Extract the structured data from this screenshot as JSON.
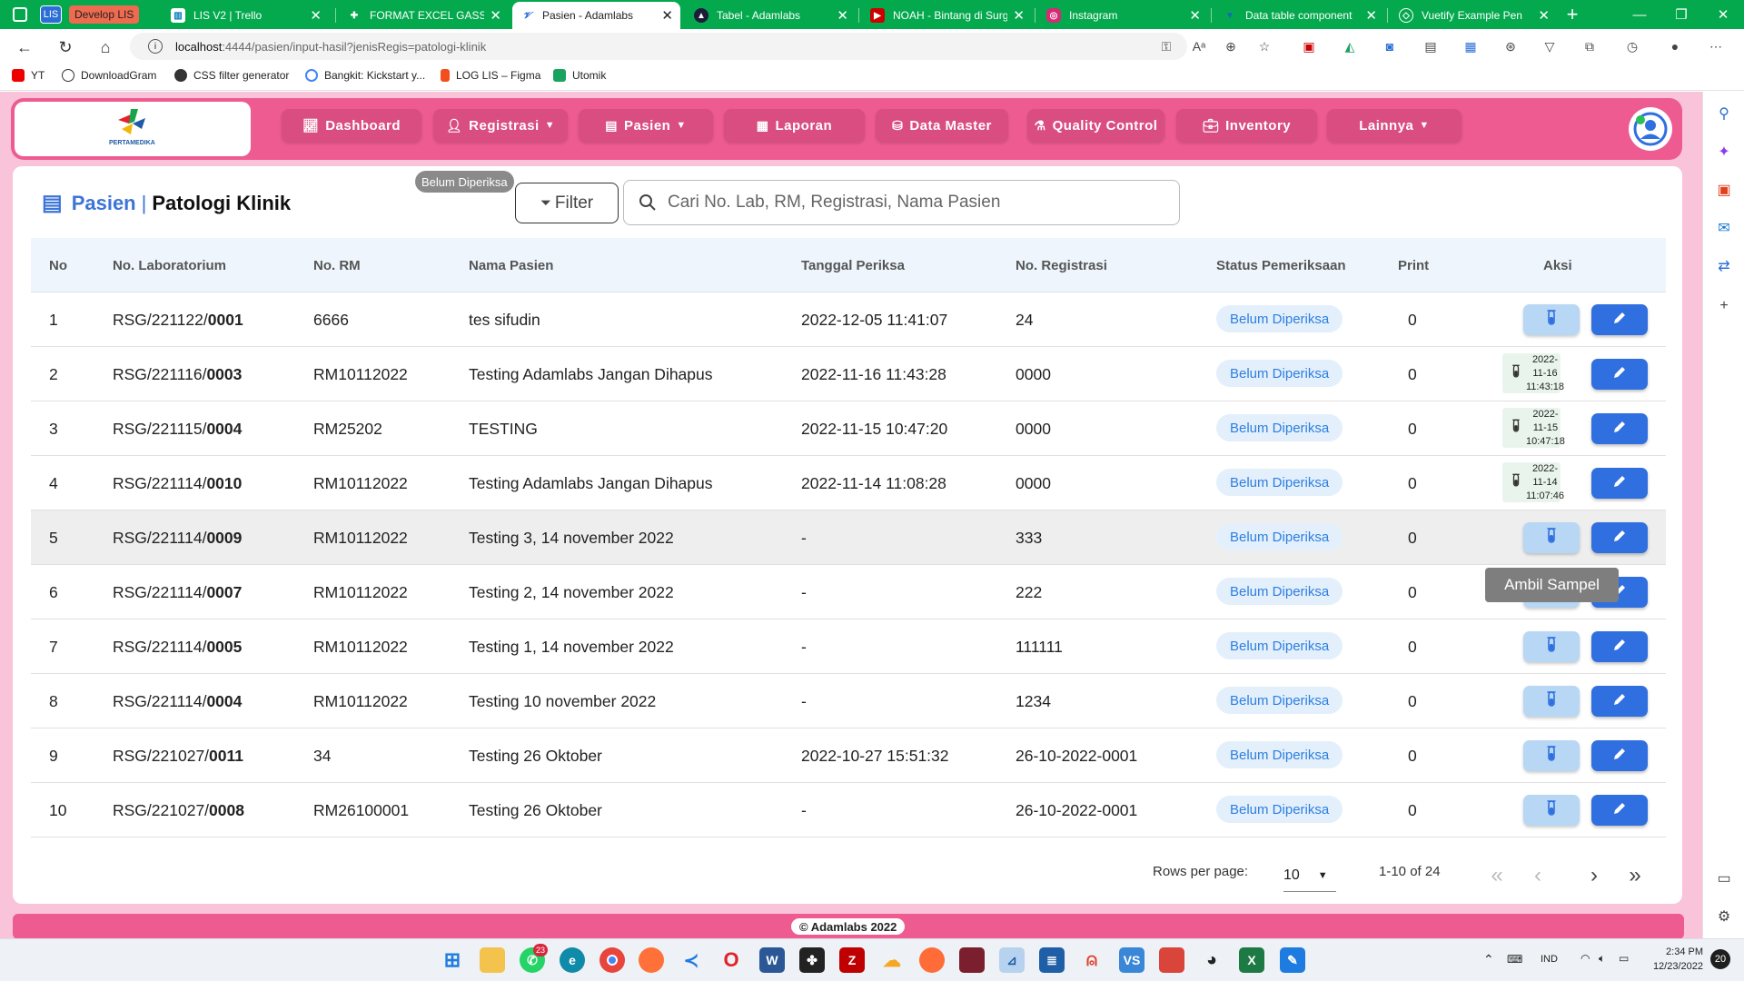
{
  "browser": {
    "tabs": [
      {
        "label": "Develop LIS",
        "type": "group"
      },
      {
        "label": "LIS V2 | Trello"
      },
      {
        "label": "FORMAT EXCEL GASS.xlsx"
      },
      {
        "label": "Pasien - Adamlabs",
        "active": true
      },
      {
        "label": "Tabel - Adamlabs"
      },
      {
        "label": "NOAH - Bintang di Surga"
      },
      {
        "label": "Instagram"
      },
      {
        "label": "Data table component"
      },
      {
        "label": "Vuetify Example Pen"
      }
    ],
    "group_label": "LIS",
    "url_host": "localhost",
    "url_rest": ":4444/pasien/input-hasil?jenisRegis=patologi-klinik",
    "bookmarks": [
      "YT",
      "DownloadGram",
      "CSS filter generator",
      "Bangkit: Kickstart y...",
      "LOG LIS – Figma",
      "Utomik"
    ]
  },
  "app": {
    "logo_text": "PERTAMEDIKA",
    "nav": [
      {
        "label": "Dashboard",
        "icon": "chart-line-icon",
        "dropdown": false
      },
      {
        "label": "Registrasi",
        "icon": "user-plus-icon",
        "dropdown": true
      },
      {
        "label": "Pasien",
        "icon": "clipboard-icon",
        "dropdown": true
      },
      {
        "label": "Laporan",
        "icon": "newspaper-icon",
        "dropdown": false
      },
      {
        "label": "Data Master",
        "icon": "database-icon",
        "dropdown": false
      },
      {
        "label": "Quality Control",
        "icon": "vials-icon",
        "dropdown": false
      },
      {
        "label": "Inventory",
        "icon": "briefcase-icon",
        "dropdown": false
      },
      {
        "label": "Lainnya",
        "icon": "",
        "dropdown": true
      }
    ],
    "colors": {
      "brand": "#ee5b91",
      "accent": "#3d74d8",
      "status_bg": "#e3f0fc",
      "status_text": "#2f7ee0"
    }
  },
  "page": {
    "title_prefix": "Pasien",
    "title_separator": "|",
    "title_main": "Patologi Klinik",
    "filter_badge": "Belum Diperiksa",
    "filter_label": "Filter",
    "search_placeholder": "Cari No. Lab, RM, Registrasi, Nama Pasien"
  },
  "table": {
    "headers": [
      "No",
      "No. Laboratorium",
      "No. RM",
      "Nama Pasien",
      "Tanggal Periksa",
      "No. Registrasi",
      "Status Pemeriksaan",
      "Print",
      "Aksi"
    ],
    "rows": [
      {
        "no": "1",
        "lab_prefix": "RSG/221122/",
        "lab_suffix": "0001",
        "rm": "6666",
        "nama": "tes sifudin",
        "tanggal": "2022-12-05 11:41:07",
        "registrasi": "24",
        "status": "Belum Diperiksa",
        "print": "0",
        "sample": null
      },
      {
        "no": "2",
        "lab_prefix": "RSG/221116/",
        "lab_suffix": "0003",
        "rm": "RM10112022",
        "nama": "Testing Adamlabs Jangan Dihapus",
        "tanggal": "2022-11-16 11:43:28",
        "registrasi": "0000",
        "status": "Belum Diperiksa",
        "print": "0",
        "sample": {
          "date": "2022-11-16",
          "time": "11:43:18"
        }
      },
      {
        "no": "3",
        "lab_prefix": "RSG/221115/",
        "lab_suffix": "0004",
        "rm": "RM25202",
        "nama": "TESTING",
        "tanggal": "2022-11-15 10:47:20",
        "registrasi": "0000",
        "status": "Belum Diperiksa",
        "print": "0",
        "sample": {
          "date": "2022-11-15",
          "time": "10:47:18"
        }
      },
      {
        "no": "4",
        "lab_prefix": "RSG/221114/",
        "lab_suffix": "0010",
        "rm": "RM10112022",
        "nama": "Testing Adamlabs Jangan Dihapus",
        "tanggal": "2022-11-14 11:08:28",
        "registrasi": "0000",
        "status": "Belum Diperiksa",
        "print": "0",
        "sample": {
          "date": "2022-11-14",
          "time": "11:07:46"
        }
      },
      {
        "no": "5",
        "lab_prefix": "RSG/221114/",
        "lab_suffix": "0009",
        "rm": "RM10112022",
        "nama": "Testing 3, 14 november 2022",
        "tanggal": "-",
        "registrasi": "333",
        "status": "Belum Diperiksa",
        "print": "0",
        "sample": null
      },
      {
        "no": "6",
        "lab_prefix": "RSG/221114/",
        "lab_suffix": "0007",
        "rm": "RM10112022",
        "nama": "Testing 2, 14 november 2022",
        "tanggal": "-",
        "registrasi": "222",
        "status": "Belum Diperiksa",
        "print": "0",
        "sample": null
      },
      {
        "no": "7",
        "lab_prefix": "RSG/221114/",
        "lab_suffix": "0005",
        "rm": "RM10112022",
        "nama": "Testing 1, 14 november 2022",
        "tanggal": "-",
        "registrasi": "111111",
        "status": "Belum Diperiksa",
        "print": "0",
        "sample": null
      },
      {
        "no": "8",
        "lab_prefix": "RSG/221114/",
        "lab_suffix": "0004",
        "rm": "RM10112022",
        "nama": "Testing 10 november 2022",
        "tanggal": "-",
        "registrasi": "1234",
        "status": "Belum Diperiksa",
        "print": "0",
        "sample": null
      },
      {
        "no": "9",
        "lab_prefix": "RSG/221027/",
        "lab_suffix": "0011",
        "rm": "34",
        "nama": "Testing 26 Oktober",
        "tanggal": "2022-10-27 15:51:32",
        "registrasi": "26-10-2022-0001",
        "status": "Belum Diperiksa",
        "print": "0",
        "sample": null
      },
      {
        "no": "10",
        "lab_prefix": "RSG/221027/",
        "lab_suffix": "0008",
        "rm": "RM26100001",
        "nama": "Testing 26 Oktober",
        "tanggal": "-",
        "registrasi": "26-10-2022-0001",
        "status": "Belum Diperiksa",
        "print": "0",
        "sample": null
      }
    ],
    "hover_row": 5,
    "tooltip": "Ambil Sampel"
  },
  "pagination": {
    "rows_per_page_label": "Rows per page:",
    "rows_per_page": "10",
    "range": "1-10 of 24"
  },
  "footer": {
    "copyright": "© Adamlabs 2022"
  },
  "taskbar": {
    "whatsapp_badge": "23",
    "lang": "IND",
    "time": "2:34 PM",
    "date": "12/23/2022",
    "notif_count": "20"
  }
}
